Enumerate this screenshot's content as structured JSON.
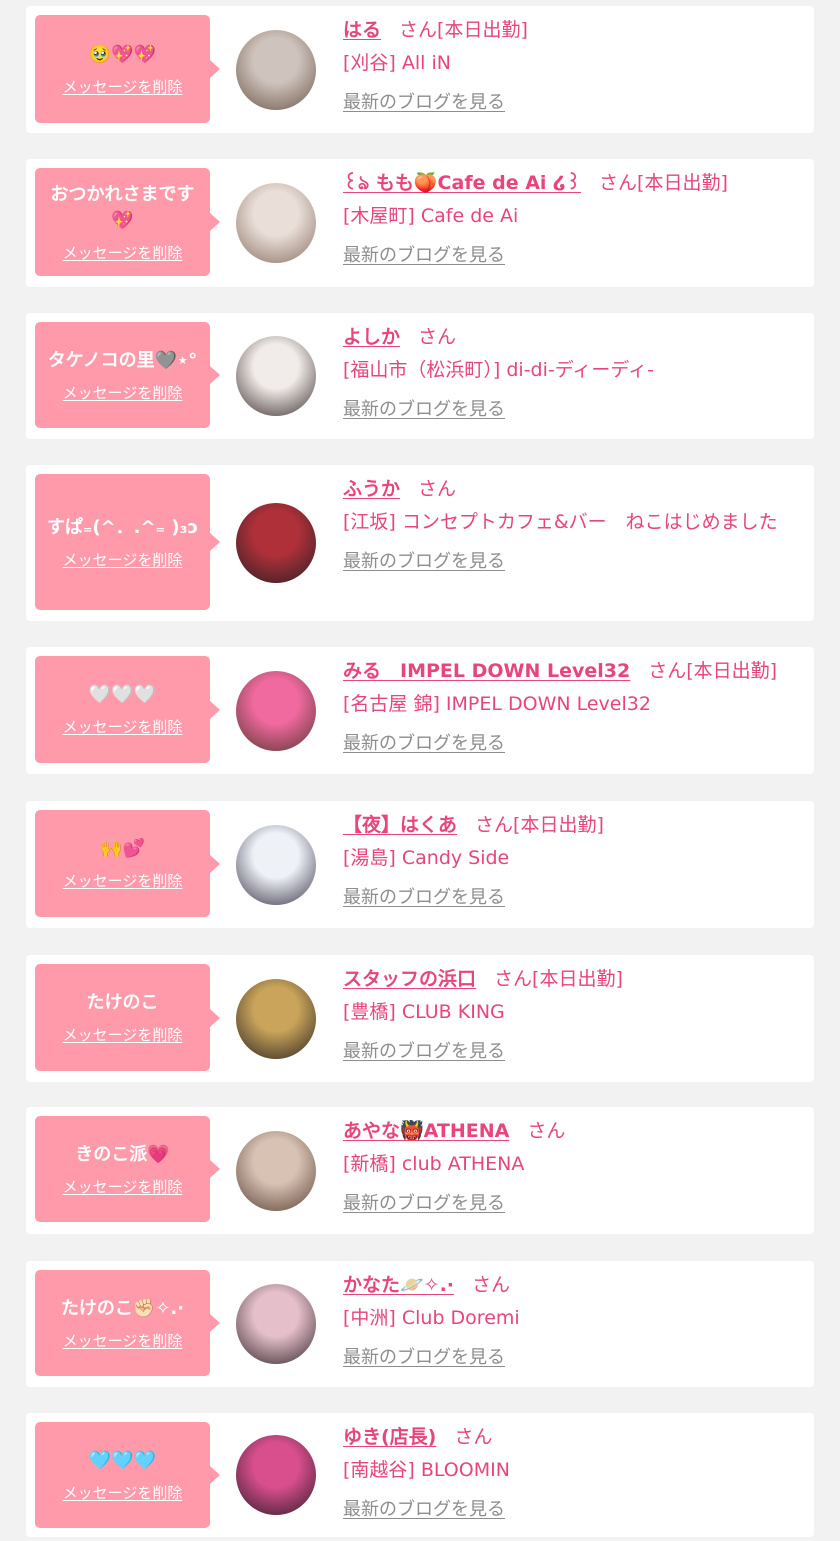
{
  "delete_label": "メッセージを削除",
  "blog_label": "最新のブログを見る",
  "san_label": "さん",
  "colors": {
    "accent": "#e8457a",
    "bubble": "#ff9aab",
    "muted": "#8d8d8d"
  },
  "items": [
    {
      "message": "🥹💖💖",
      "name": "はる",
      "status": "[本日出勤]",
      "shop": "[刈谷] All iN",
      "avatar_colors": [
        "#cfc4bd",
        "#6b5648"
      ]
    },
    {
      "message": "おつかれさまです💖",
      "name": "꒰ঌ もも🍑Cafe de Ai ໒꒱",
      "status": "[本日出勤]",
      "shop": "[木屋町] Cafe de Ai",
      "avatar_colors": [
        "#e9dfd8",
        "#8a7063"
      ]
    },
    {
      "message": "タケノコの里🩶⋆°",
      "name": "よしか",
      "status": "",
      "shop": "[福山市（松浜町）] di-di-ディーディ-",
      "avatar_colors": [
        "#f1ece9",
        "#3b2f2f"
      ]
    },
    {
      "message": "すぱ₌(^．.^₌ )₃ɔ",
      "name": "ふうか",
      "status": "",
      "shop": "[江坂] コンセプトカフェ&バー　ねこはじめました",
      "avatar_colors": [
        "#b0303a",
        "#2a1f22"
      ]
    },
    {
      "message": "🤍🤍🤍",
      "name": "みる　IMPEL DOWN Level32",
      "status": "[本日出勤]",
      "shop": "[名古屋 錦] IMPEL DOWN Level32",
      "avatar_colors": [
        "#f06aa0",
        "#5a3530"
      ]
    },
    {
      "message": "🙌💕",
      "name": "【夜】はくあ",
      "status": "[本日出勤]",
      "shop": "[湯島] Candy Side",
      "avatar_colors": [
        "#eef2f7",
        "#3a3447"
      ]
    },
    {
      "message": "たけのこ",
      "name": "スタッフの浜口",
      "status": "[本日出勤]",
      "shop": "[豊橋] CLUB KING",
      "avatar_colors": [
        "#c9a45a",
        "#2b2320"
      ]
    },
    {
      "message": "きのこ派💗",
      "name": "あやな👹ATHENA",
      "status": "",
      "shop": "[新橋] club ATHENA",
      "avatar_colors": [
        "#d8c2b4",
        "#5b4336"
      ]
    },
    {
      "message": "たけのこ✊🏻✧.·",
      "name": "かなた🪐✧.·",
      "status": "",
      "shop": "[中洲] Club Doremi",
      "avatar_colors": [
        "#e5bfc9",
        "#33262c"
      ]
    },
    {
      "message": "🩵🩵🩵",
      "name": "ゆき(店長)",
      "status": "",
      "shop": "[南越谷] BLOOMIN",
      "avatar_colors": [
        "#d94f8e",
        "#2e1b27"
      ]
    }
  ]
}
